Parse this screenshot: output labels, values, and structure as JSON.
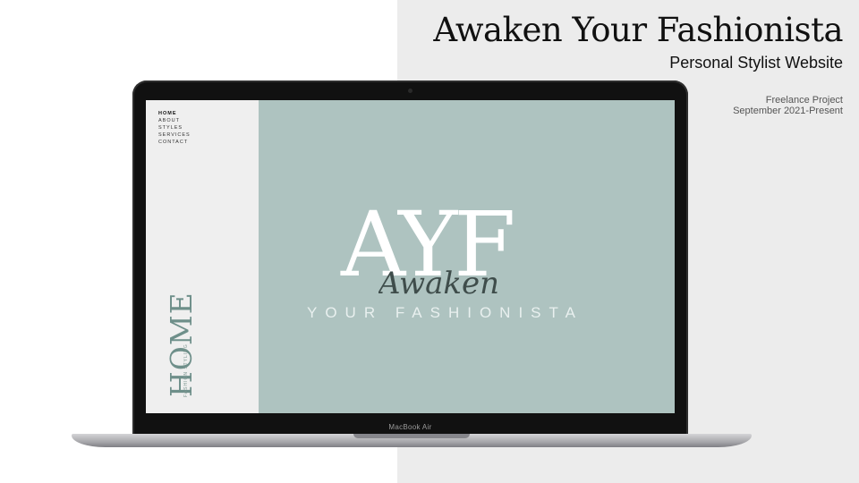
{
  "slide": {
    "title": "Awaken Your Fashionista",
    "subtitle": "Personal Stylist Website",
    "project_type": "Freelance Project",
    "project_dates": "September 2021-Present"
  },
  "laptop": {
    "brand_label": "MacBook Air"
  },
  "website": {
    "nav": [
      {
        "label": "HOME",
        "active": true
      },
      {
        "label": "ABOUT"
      },
      {
        "label": "STYLES"
      },
      {
        "label": "SERVICES"
      },
      {
        "label": "CONTACT"
      }
    ],
    "vertical_heading": "HOME",
    "vertical_subheading": "FASHION STYLING",
    "logo_monogram": "AYF",
    "logo_script": "Awaken",
    "logo_tagline": "YOUR FASHIONISTA",
    "colors": {
      "panel": "#aec3c0",
      "sidebar": "#efefef",
      "accent": "#6e8f8a"
    }
  }
}
